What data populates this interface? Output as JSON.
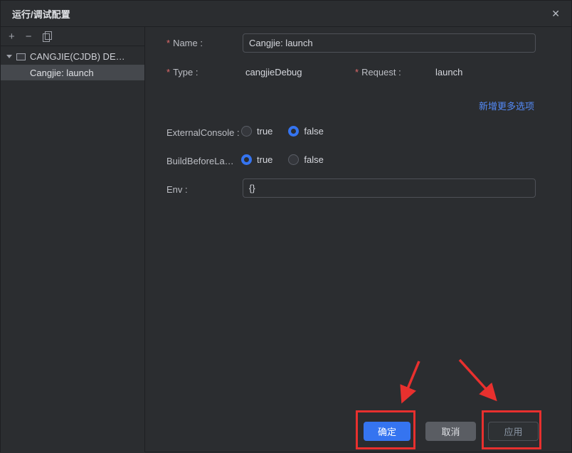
{
  "window": {
    "title": "运行/调试配置",
    "close": "✕"
  },
  "sidebar": {
    "toolbar": {
      "add": "+",
      "remove": "−"
    },
    "tree": {
      "group_label": "CANGJIE(CJDB) DE…",
      "child_label": "Cangjie: launch"
    }
  },
  "form": {
    "required_mark": "*",
    "name_label": "Name :",
    "name_value": "Cangjie: launch",
    "type_label": "Type :",
    "type_value": "cangjieDebug",
    "request_label": "Request :",
    "request_value": "launch",
    "more_link": "新增更多选项",
    "external_console_label": "ExternalConsole :",
    "build_before_label": "BuildBeforeLa…",
    "radio_true": "true",
    "radio_false": "false",
    "env_label": "Env :",
    "env_value": "{}"
  },
  "buttons": {
    "ok": "确定",
    "cancel": "取消",
    "apply": "应用"
  },
  "colors": {
    "accent": "#3574f0",
    "link": "#548af7",
    "annotation": "#e8302e"
  }
}
